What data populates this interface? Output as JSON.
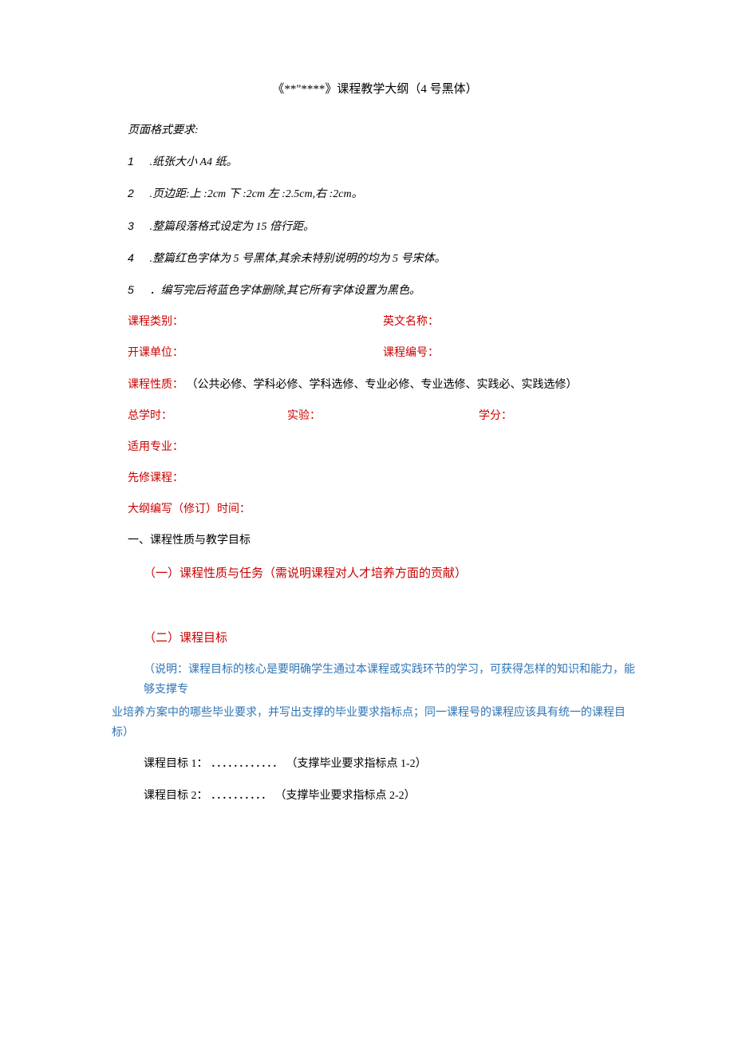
{
  "title": "《**\"****》课程教学大纲（4 号黑体）",
  "format_header": "页面格式要求:",
  "rules": {
    "r1_num": "1",
    "r1_text": ".纸张大小 A4 纸。",
    "r2_num": "2",
    "r2_text": ".页边距:上 :2cm 下 :2cm 左 :2.5cm,右 :2cm。",
    "r3_num": "3",
    "r3_text": ".整篇段落格式设定为 15 倍行距。",
    "r4_num": "4",
    "r4_text": ".整篇红色字体为 5 号黑体,其余未特别说明的均为 5 号宋体。",
    "r5_num": "5",
    "r5_text": "．编写完后将蓝色字体删除,其它所有字体设置为黑色。"
  },
  "fields": {
    "course_category": "课程类别：",
    "english_name": "英文名称：",
    "offering_unit": "开课单位：",
    "course_code": "课程编号：",
    "course_nature_label": "课程性质：",
    "course_nature_options": "（公共必修、学科必修、学科选修、专业必修、专业选修、实践必、实践选修）",
    "total_hours": "总学时：",
    "experiment": "实验：",
    "credits": "学分：",
    "applicable_major": "适用专业：",
    "prerequisite": "先修课程：",
    "revision_time": "大纲编写（修订）时间："
  },
  "section1": "一、课程性质与教学目标",
  "sub1": "（一）课程性质与任务（需说明课程对人才培养方面的贡献）",
  "sub2": "（二）课程目标",
  "note_line1": "（说明：课程目标的核心是要明确学生通过本课程或实践环节的学习，可获得怎样的知识和能力，能够支撑专",
  "note_line2": "业培养方案中的哪些毕业要求，并写出支撑的毕业要求指标点；同一课程号的课程应该具有统一的课程目标）",
  "objectives": {
    "obj1_label": "课程目标 1：",
    "obj1_dots": "．．．．．．．．．．．．",
    "obj1_note": "（支撑毕业要求指标点 1-2）",
    "obj2_label": "课程目标 2：",
    "obj2_dots": "．．．．．．．．．．",
    "obj2_note": "（支撑毕业要求指标点 2-2）"
  }
}
